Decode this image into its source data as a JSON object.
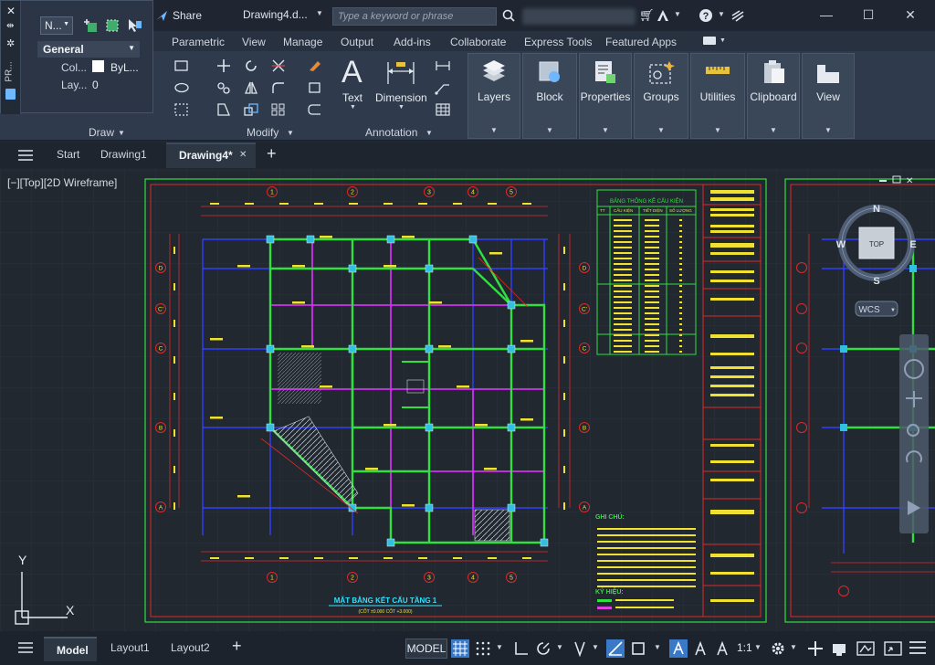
{
  "window": {
    "title": "Drawing4.d...",
    "share_label": "Share",
    "search_placeholder": "Type a keyword or phrase",
    "minimize": "—",
    "maximize": "☐",
    "close": "✕"
  },
  "ribbon_tabs": [
    "Parametric",
    "View",
    "Manage",
    "Output",
    "Add-ins",
    "Collaborate",
    "Express Tools",
    "Featured Apps"
  ],
  "panels": {
    "draw": "Draw",
    "modify": "Modify",
    "annotation": "Annotation",
    "text": "Text",
    "dimension": "Dimension",
    "layers": "Layers",
    "block": "Block",
    "properties": "Properties",
    "groups": "Groups",
    "utilities": "Utilities",
    "clipboard": "Clipboard",
    "view": "View"
  },
  "float_panel": {
    "side_label": "PR...",
    "dropdown": "N...",
    "general": "General",
    "color_label": "Col...",
    "color_value": "ByL...",
    "layer_label": "Lay...",
    "layer_value": "0"
  },
  "doc_tabs": {
    "start": "Start",
    "drawing1": "Drawing1",
    "drawing4": "Drawing4*",
    "close": "✕",
    "add": "+"
  },
  "viewport": {
    "view_label": "[−][Top][2D Wireframe]",
    "compass": {
      "n": "N",
      "s": "S",
      "e": "E",
      "w": "W",
      "top": "TOP",
      "wcs": "WCS"
    },
    "ucs_x": "X",
    "ucs_y": "Y",
    "plan_title": "MẶT BẰNG KẾT CẤU TẦNG 1",
    "plan_subtitle": "(CỐT ±0.000 CỐT +3.000)",
    "table_title": "BẢNG THỐNG KÊ CẤU KIỆN",
    "table_headers": [
      "TT",
      "CẤU KIỆN",
      "TIẾT DIỆN",
      "SỐ LƯỢNG"
    ],
    "notes_title": "GHI CHÚ:",
    "symbols_title": "KÝ HIỆU:",
    "grid_cols": [
      "1",
      "2",
      "3",
      "4",
      "5"
    ],
    "grid_rows": [
      "D",
      "C'",
      "C",
      "B",
      "A"
    ]
  },
  "status": {
    "model_tab": "Model",
    "layout1": "Layout1",
    "layout2": "Layout2",
    "add": "+",
    "model_btn": "MODEL",
    "scale": "1:1"
  }
}
